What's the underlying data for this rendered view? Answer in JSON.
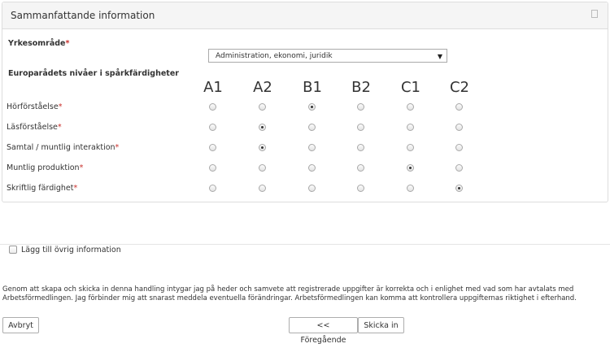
{
  "panel": {
    "title": "Sammanfattande information",
    "collapse_icon": "collapse-icon"
  },
  "occupation": {
    "label": "Yrkesområde",
    "required_mark": "*",
    "selected": "Administration, ekonomi, juridik"
  },
  "language": {
    "section_label": "Europarådets nivåer i spårkfärdigheter",
    "levels": [
      "A1",
      "A2",
      "B1",
      "B2",
      "C1",
      "C2"
    ],
    "rows": [
      {
        "label": "Hörförståelse",
        "selected": "B1"
      },
      {
        "label": "Läsförståelse",
        "selected": "A2"
      },
      {
        "label": "Samtal / muntlig interaktion",
        "selected": "A2"
      },
      {
        "label": "Muntlig produktion",
        "selected": "C1"
      },
      {
        "label": "Skriftlig färdighet",
        "selected": "C2"
      }
    ]
  },
  "extra_info": {
    "label": "Lägg till övrig information",
    "checked": false
  },
  "disclaimer": "Genom att skapa och skicka in denna handling intygar jag på heder och samvete att registrerade uppgifter är korrekta och i enlighet med vad som har avtalats med Arbetsförmedlingen. Jag förbinder mig att snarast meddela eventuella förändringar. Arbetsförmedlingen kan komma att kontrollera uppgifternas riktighet i efterhand.",
  "buttons": {
    "cancel": "Avbryt",
    "previous": "<< Föregående",
    "submit": "Skicka in"
  },
  "colors": {
    "required": "#c9302c",
    "panel_heading_bg": "#f5f5f5",
    "border": "#dddddd"
  }
}
